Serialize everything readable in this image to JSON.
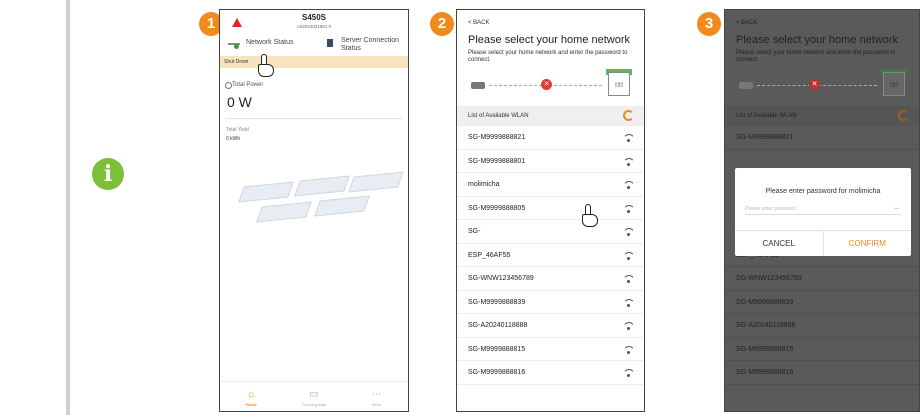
{
  "steps": [
    "1",
    "2",
    "3"
  ],
  "info_icon_glyph": "i",
  "accent_color": "#f08a1c",
  "phone1": {
    "device_name": "S450S",
    "serial": "A02024021801 0",
    "network_status": "Network Status",
    "server_status": "Server Connection Status",
    "banner": "Shut Down",
    "total_power_label": "Total Power",
    "total_power_value": "0 W",
    "total_yield_label": "Total Yield",
    "total_yield_value": "0 kWh",
    "tabs": [
      "Home",
      "Running data",
      "More"
    ]
  },
  "phone2": {
    "back": "< BACK",
    "title": "Please select your home network",
    "description": "Please select your home network and enter the password to connect.",
    "wlan_header": "List of Available WLAN",
    "networks": [
      "SG-M9999888821",
      "SG-M9999888801",
      "molimicha",
      "SG-M9999888805",
      "SG-",
      "ESP_46AF55",
      "SG-WNW123456789",
      "SG-M9999888839",
      "SG-A20240118888",
      "SG-M9999888815",
      "SG-M9999888816"
    ]
  },
  "phone3": {
    "back": "< BACK",
    "title": "Please select your home network",
    "description": "Please select your home network and enter the password to connect.",
    "wlan_header": "List of Available WLAN",
    "networks_top": [
      "SG-M9999888821"
    ],
    "networks_bottom": [
      "ESP_46AF55",
      "SG-WNW123456789",
      "SG-M9999888839",
      "SG-A20240118888",
      "SG-M9999888815",
      "SG-M9999888816"
    ],
    "dialog_title": "Please enter password for molimicha",
    "dialog_placeholder": "Please enter password",
    "cancel": "CANCEL",
    "confirm": "CONFIRM"
  }
}
